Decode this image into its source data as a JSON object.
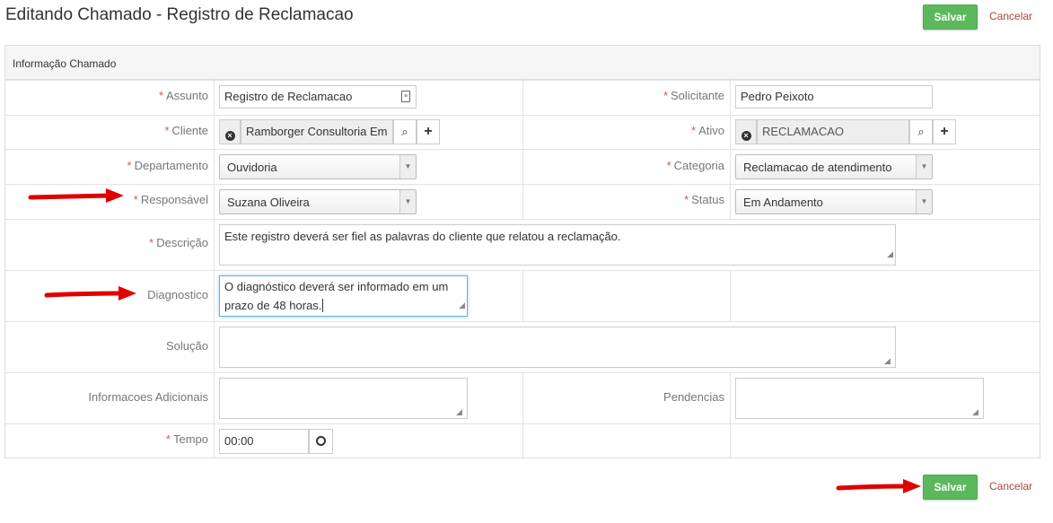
{
  "page": {
    "title": "Editando Chamado - Registro de Reclamacao"
  },
  "actions": {
    "save_label": "Salvar",
    "cancel_label": "Cancelar"
  },
  "panel": {
    "heading": "Informação Chamado"
  },
  "fields": {
    "assunto": {
      "label": "Assunto",
      "value": "Registro de Reclamacao",
      "required": true
    },
    "solicitante": {
      "label": "Solicitante",
      "value": "Pedro Peixoto",
      "required": true
    },
    "cliente": {
      "label": "Cliente",
      "value": "Ramborger Consultoria Em",
      "required": true
    },
    "ativo": {
      "label": "Ativo",
      "value": "RECLAMACAO",
      "required": true
    },
    "departamento": {
      "label": "Departamento",
      "value": "Ouvidoria",
      "required": true
    },
    "categoria": {
      "label": "Categoria",
      "value": "Reclamacao de atendimento",
      "required": true
    },
    "responsavel": {
      "label": "Responsável",
      "value": "Suzana Oliveira",
      "required": true
    },
    "status": {
      "label": "Status",
      "value": "Em Andamento",
      "required": true
    },
    "descricao": {
      "label": "Descrição",
      "value": "Este registro deverá ser fiel as palavras do cliente que relatou a reclamação.",
      "required": true
    },
    "diagnostico": {
      "label": "Diagnostico",
      "value_line1": "O diagnóstico deverá ser informado em um",
      "value_line2": "prazo de 48 horas.",
      "required": false
    },
    "solucao": {
      "label": "Solução",
      "value": "",
      "required": false
    },
    "informacoes": {
      "label": "Informacoes Adicionais",
      "value": "",
      "required": false
    },
    "pendencias": {
      "label": "Pendencias",
      "value": "",
      "required": false
    },
    "tempo": {
      "label": "Tempo",
      "value": "00:00",
      "required": true
    }
  },
  "required_marker": "*",
  "icons": {
    "assunto_field": "contact-card-icon",
    "clear": "circle-x-icon",
    "search": "search-icon",
    "add": "plus-icon",
    "clock": "clock-icon",
    "select_arrow": "caret-down-icon",
    "annotation": "red-arrow-icon"
  },
  "colors": {
    "save_button": "#5cb85c",
    "cancel_link": "#a94442",
    "required": "#d9534f",
    "annotation_arrow": "#e00000"
  }
}
